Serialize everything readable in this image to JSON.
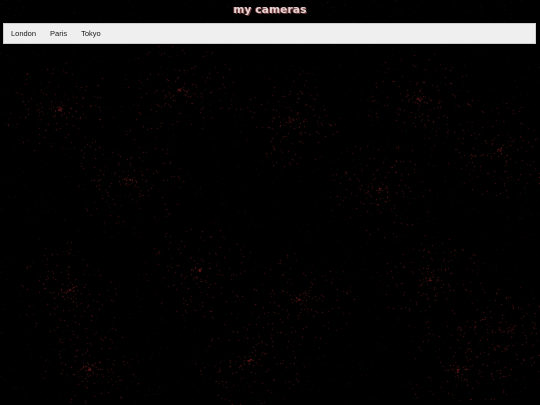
{
  "page": {
    "title": "my cameras",
    "background_color": "#000000",
    "title_color": "#e7d3d3"
  },
  "nav": {
    "background_color": "#efefef",
    "cities": [
      "London",
      "Paris",
      "Tokyo"
    ]
  },
  "feed": {
    "noise_colors": [
      "#7a1f1f",
      "#a12a2a",
      "#4a4a5a",
      "#2a5a3a",
      "#5a2020"
    ]
  }
}
